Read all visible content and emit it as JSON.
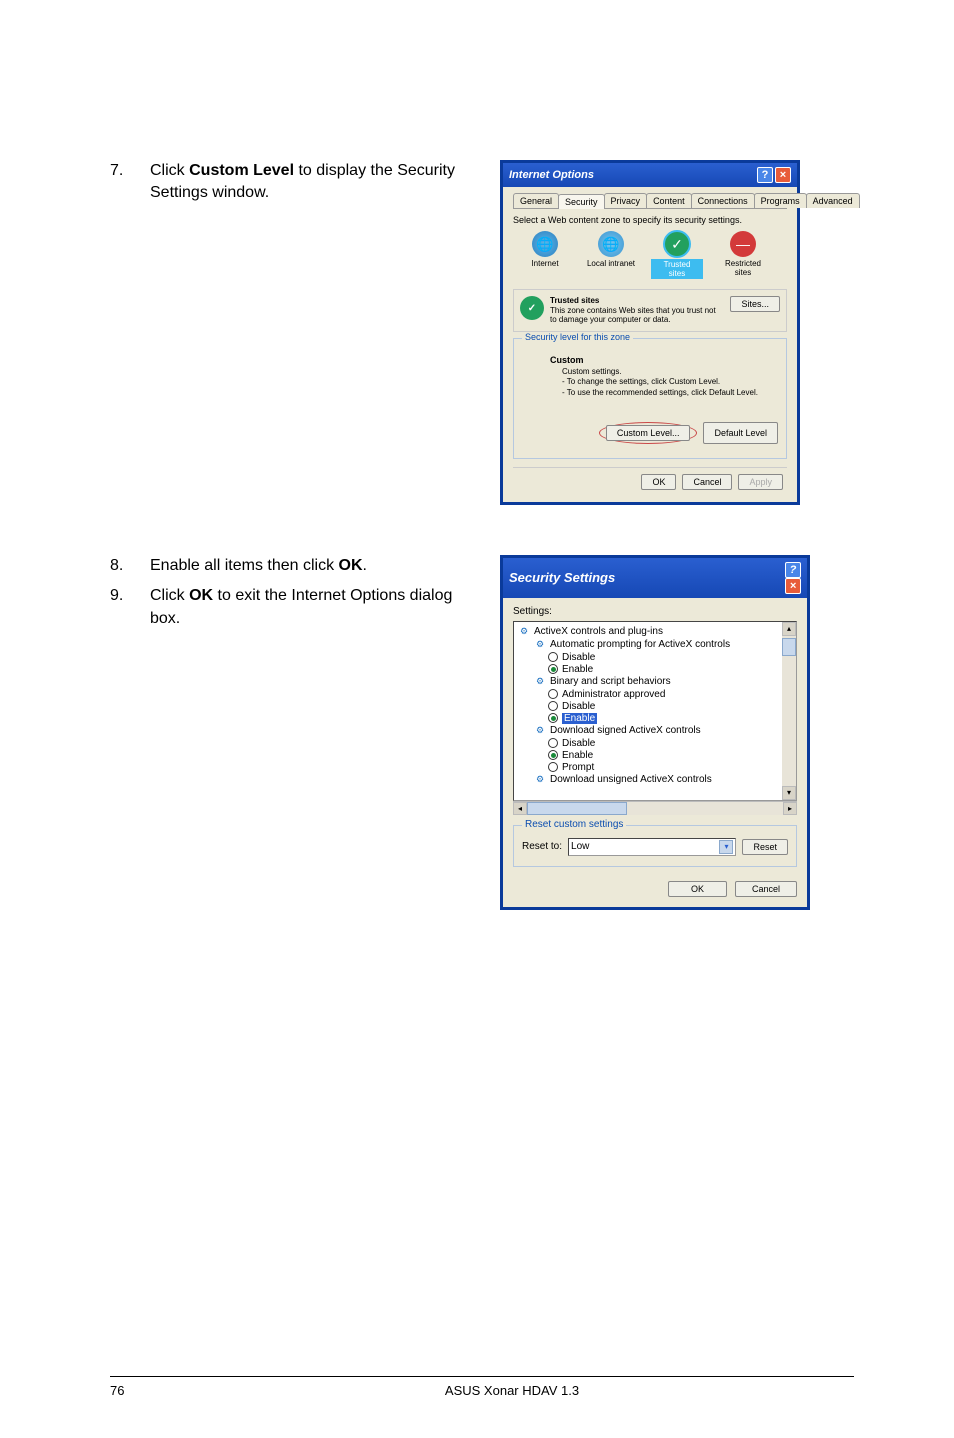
{
  "steps": {
    "s7": {
      "num": "7.",
      "pre": "Click ",
      "bold": "Custom Level",
      "post": " to display the Security Settings window."
    },
    "s8": {
      "num": "8.",
      "pre": "Enable all items then click ",
      "bold": "OK",
      "post": "."
    },
    "s9": {
      "num": "9.",
      "pre": "Click ",
      "bold": "OK",
      "post": " to exit the Internet Options dialog box."
    }
  },
  "dialog_internet_options": {
    "title": "Internet Options",
    "tabs": [
      "General",
      "Security",
      "Privacy",
      "Content",
      "Connections",
      "Programs",
      "Advanced"
    ],
    "active_tab_index": 1,
    "zone_prompt": "Select a Web content zone to specify its security settings.",
    "zones": {
      "internet": "Internet",
      "intranet": "Local intranet",
      "trusted": "Trusted sites",
      "restricted": "Restricted sites"
    },
    "trusted_heading": "Trusted sites",
    "trusted_desc": "This zone contains Web sites that you trust not to damage your computer or data.",
    "sites_btn": "Sites...",
    "security_level_legend": "Security level for this zone",
    "custom_heading": "Custom",
    "custom_line1": "Custom settings.",
    "custom_line2": "- To change the settings, click Custom Level.",
    "custom_line3": "- To use the recommended settings, click Default Level.",
    "custom_level_btn": "Custom Level...",
    "default_level_btn": "Default Level",
    "ok_btn": "OK",
    "cancel_btn": "Cancel",
    "apply_btn": "Apply"
  },
  "dialog_security_settings": {
    "title": "Security Settings",
    "settings_label": "Settings:",
    "tree": {
      "n1": "ActiveX controls and plug-ins",
      "n2": "Automatic prompting for ActiveX controls",
      "r_disable": "Disable",
      "r_enable": "Enable",
      "n3": "Binary and script behaviors",
      "r_admin": "Administrator approved",
      "n4": "Download signed ActiveX controls",
      "r_prompt": "Prompt",
      "n5": "Download unsigned ActiveX controls"
    },
    "reset_legend": "Reset custom settings",
    "reset_to_label": "Reset to:",
    "reset_value": "Low",
    "reset_btn": "Reset",
    "ok_btn": "OK",
    "cancel_btn": "Cancel"
  },
  "footer": {
    "page": "76",
    "product": "ASUS Xonar HDAV 1.3"
  }
}
